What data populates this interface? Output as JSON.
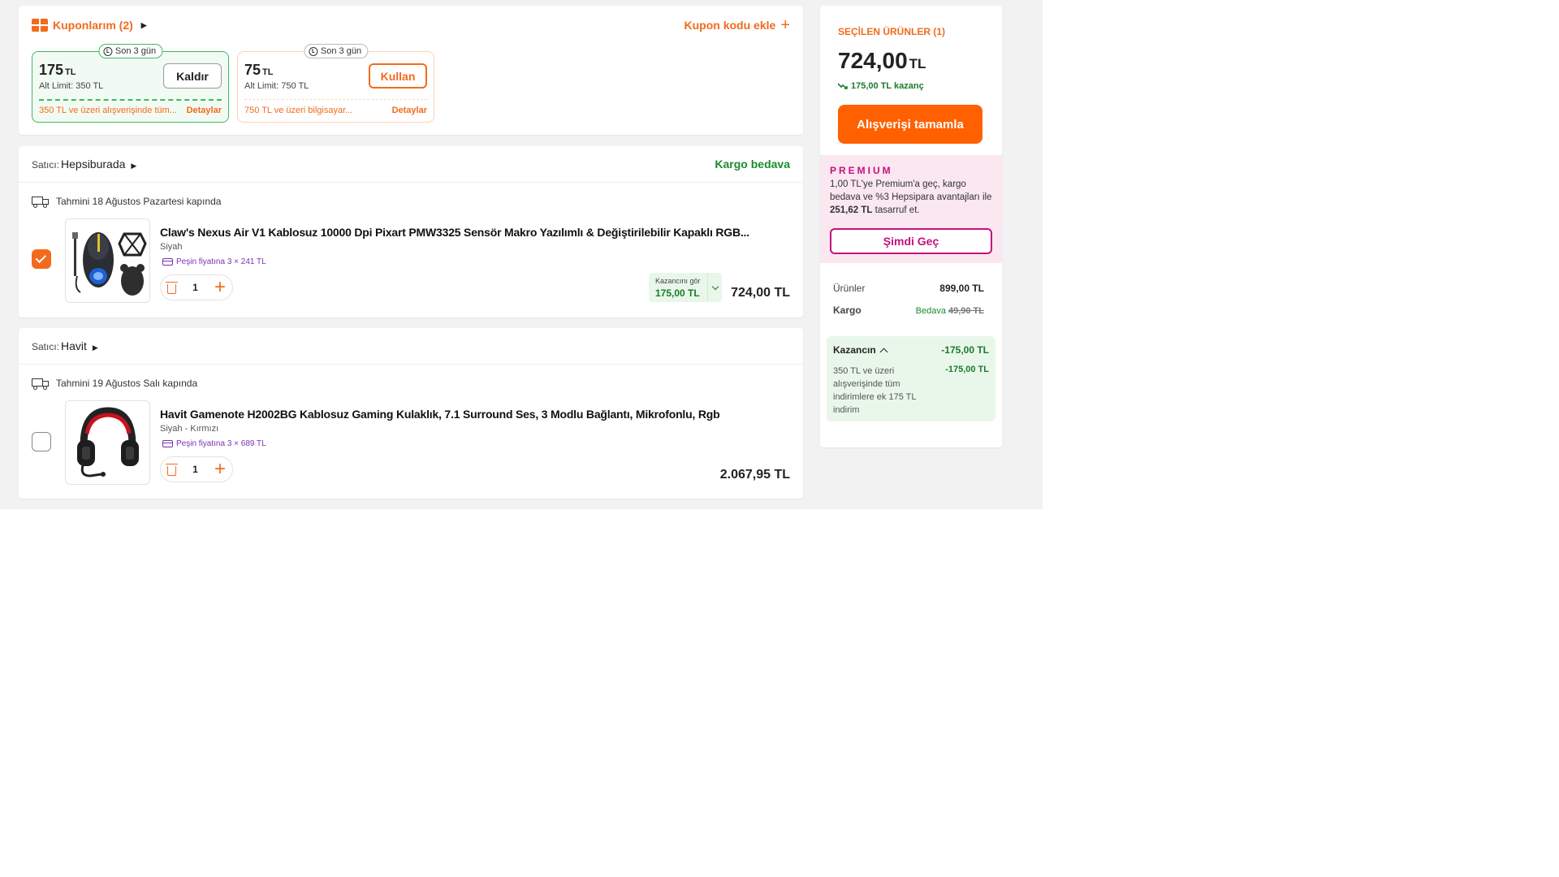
{
  "colors": {
    "accent": "#f26b1d",
    "checkout": "#ff6000",
    "green": "#1a8a2f",
    "premium": "#c2127d"
  },
  "coupons": {
    "title": "Kuponlarım (2)",
    "add_code": "Kupon kodu ekle",
    "items": [
      {
        "badge": "Son 3 gün",
        "amount": "175",
        "currency": "TL",
        "limit": "Alt Limit: 350 TL",
        "button": "Kaldır",
        "desc": "350 TL ve üzeri alışverişinde tüm...",
        "detail": "Detaylar",
        "applied": true
      },
      {
        "badge": "Son 3 gün",
        "amount": "75",
        "currency": "TL",
        "limit": "Alt Limit: 750 TL",
        "button": "Kullan",
        "desc": "750 TL ve üzeri bilgisayar...",
        "detail": "Detaylar",
        "applied": false
      }
    ]
  },
  "sellers": [
    {
      "label": "Satıcı:",
      "name": "Hepsiburada",
      "shipping": "Kargo bedava",
      "delivery": "Tahmini 18 Ağustos Pazartesi kapında",
      "product": {
        "title": "Claw's Nexus Air V1 Kablosuz 10000 Dpi Pixart PMW3325 Sensör Makro Yazılımlı & Değiştirilebilir Kapaklı RGB...",
        "variant": "Siyah",
        "installment": "Peşin fiyatına 3 × 241 TL",
        "qty": "1",
        "earn_label": "Kazancını gör",
        "earn_value": "175,00 TL",
        "price": "724,00 TL",
        "selected": true
      }
    },
    {
      "label": "Satıcı:",
      "name": "Havit",
      "shipping": "",
      "delivery": "Tahmini 19 Ağustos Salı kapında",
      "product": {
        "title": "Havit Gamenote H2002BG Kablosuz Gaming Kulaklık, 7.1 Surround Ses, 3 Modlu Bağlantı, Mikrofonlu, Rgb",
        "variant": "Siyah - Kırmızı",
        "installment": "Peşin fiyatına 3 × 689 TL",
        "qty": "1",
        "price": "2.067,95 TL",
        "selected": false
      }
    }
  ],
  "summary": {
    "selected_title": "SEÇİLEN ÜRÜNLER (1)",
    "total": "724,00",
    "total_currency": "TL",
    "saving": "175,00 TL kazanç",
    "checkout": "Alışverişi tamamla",
    "premium": {
      "tag": "PREMIUM",
      "text_1": "1,00 TL'ye Premium'a geç, kargo bedava ve %3 Hepsipara avantajları ile",
      "amount": "251,62 TL",
      "text_2": "tasarruf et.",
      "button": "Şimdi Geç"
    },
    "products_label": "Ürünler",
    "products_value": "899,00 TL",
    "shipping_label": "Kargo",
    "shipping_free": "Bedava",
    "shipping_old": "49,90 TL",
    "gain_label": "Kazancın",
    "gain_value": "-175,00 TL",
    "gain_desc": "350 TL ve üzeri alışverişinde tüm indirimlere ek 175 TL indirim",
    "gain_desc_value": "-175,00 TL"
  }
}
